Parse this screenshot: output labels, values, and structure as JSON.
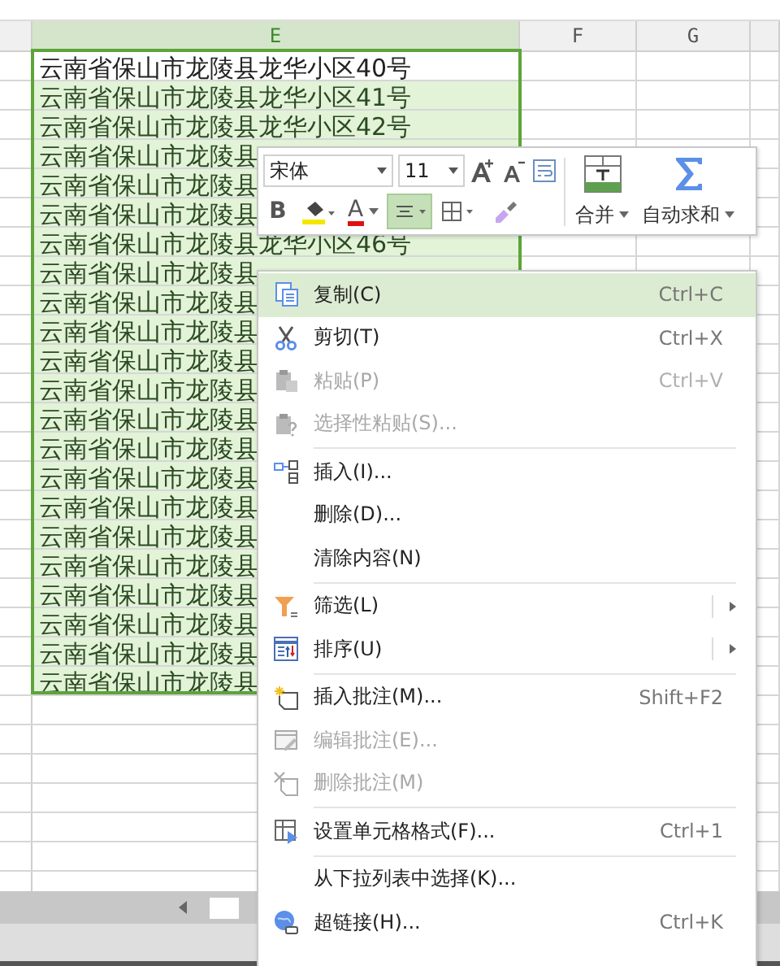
{
  "sheet": {
    "columns": [
      {
        "label": "E",
        "selected": true
      },
      {
        "label": "F",
        "selected": false
      },
      {
        "label": "G",
        "selected": false
      }
    ],
    "rows": [
      {
        "text": "云南省保山市龙陵县龙华小区40号",
        "active": true,
        "selected": true
      },
      {
        "text": "云南省保山市龙陵县龙华小区41号",
        "active": false,
        "selected": true
      },
      {
        "text": "云南省保山市龙陵县龙华小区42号",
        "active": false,
        "selected": true
      },
      {
        "text": "云南省保山市龙陵县",
        "active": false,
        "selected": true
      },
      {
        "text": "云南省保山市龙陵县",
        "active": false,
        "selected": true
      },
      {
        "text": "云南省保山市龙陵县",
        "active": false,
        "selected": true
      },
      {
        "text": "云南省保山市龙陵县龙华小区46号",
        "active": false,
        "selected": true
      },
      {
        "text": "云南省保山市龙陵县",
        "active": false,
        "selected": true
      },
      {
        "text": "云南省保山市龙陵县",
        "active": false,
        "selected": true
      },
      {
        "text": "云南省保山市龙陵县",
        "active": false,
        "selected": true
      },
      {
        "text": "云南省保山市龙陵县",
        "active": false,
        "selected": true
      },
      {
        "text": "云南省保山市龙陵县",
        "active": false,
        "selected": true
      },
      {
        "text": "云南省保山市龙陵县",
        "active": false,
        "selected": true
      },
      {
        "text": "云南省保山市龙陵县",
        "active": false,
        "selected": true
      },
      {
        "text": "云南省保山市龙陵县",
        "active": false,
        "selected": true
      },
      {
        "text": "云南省保山市龙陵县",
        "active": false,
        "selected": true
      },
      {
        "text": "云南省保山市龙陵县",
        "active": false,
        "selected": true
      },
      {
        "text": "云南省保山市龙陵县",
        "active": false,
        "selected": true
      },
      {
        "text": "云南省保山市龙陵县",
        "active": false,
        "selected": true
      },
      {
        "text": "云南省保山市龙陵县",
        "active": false,
        "selected": true
      },
      {
        "text": "云南省保山市龙陵县",
        "active": false,
        "selected": true
      },
      {
        "text": "云南省保山市龙陵县",
        "active": false,
        "selected": true
      }
    ]
  },
  "mini_toolbar": {
    "font": "宋体",
    "size": "11",
    "merge": "合并",
    "autosum": "自动求和",
    "buttons": [
      {
        "kind": "bold",
        "label": "B",
        "selected": false
      },
      {
        "kind": "fill",
        "selected": false
      },
      {
        "kind": "fontcolor",
        "label": "A",
        "selected": false
      },
      {
        "kind": "align",
        "selected": true
      },
      {
        "kind": "border",
        "selected": false
      },
      {
        "kind": "painter",
        "selected": false
      }
    ]
  },
  "context_menu": [
    {
      "kind": "copy",
      "label": "复制(C)",
      "shortcut": "Ctrl+C",
      "disabled": false,
      "selected": true,
      "submenu": false
    },
    {
      "kind": "cut",
      "label": "剪切(T)",
      "shortcut": "Ctrl+X",
      "disabled": false,
      "selected": false,
      "submenu": false
    },
    {
      "kind": "paste",
      "label": "粘贴(P)",
      "shortcut": "Ctrl+V",
      "disabled": true,
      "selected": false,
      "submenu": false
    },
    {
      "kind": "paste_special",
      "label": "选择性粘贴(S)...",
      "disabled": true,
      "selected": false,
      "submenu": false
    },
    {
      "kind": "separator"
    },
    {
      "kind": "insert",
      "label": "插入(I)...",
      "disabled": false,
      "selected": false,
      "submenu": false
    },
    {
      "kind": "plain",
      "label": "删除(D)...",
      "disabled": false,
      "selected": false,
      "submenu": false
    },
    {
      "kind": "plain",
      "label": "清除内容(N)",
      "disabled": false,
      "selected": false,
      "submenu": false
    },
    {
      "kind": "separator"
    },
    {
      "kind": "filter",
      "label": "筛选(L)",
      "disabled": false,
      "selected": false,
      "submenu": true
    },
    {
      "kind": "sort",
      "label": "排序(U)",
      "disabled": false,
      "selected": false,
      "submenu": true
    },
    {
      "kind": "separator"
    },
    {
      "kind": "comment_add",
      "label": "插入批注(M)...",
      "shortcut": "Shift+F2",
      "disabled": false,
      "selected": false,
      "submenu": false
    },
    {
      "kind": "comment_edit",
      "label": "编辑批注(E)...",
      "disabled": true,
      "selected": false,
      "submenu": false
    },
    {
      "kind": "comment_delete",
      "label": "删除批注(M)",
      "disabled": true,
      "selected": false,
      "submenu": false
    },
    {
      "kind": "separator"
    },
    {
      "kind": "format",
      "label": "设置单元格格式(F)...",
      "shortcut": "Ctrl+1",
      "disabled": false,
      "selected": false,
      "submenu": false
    },
    {
      "kind": "separator"
    },
    {
      "kind": "plain",
      "label": "从下拉列表中选择(K)...",
      "disabled": false,
      "selected": false,
      "submenu": false
    },
    {
      "kind": "hyperlink",
      "label": "超链接(H)...",
      "shortcut": "Ctrl+K",
      "disabled": false,
      "selected": false,
      "submenu": false
    }
  ]
}
